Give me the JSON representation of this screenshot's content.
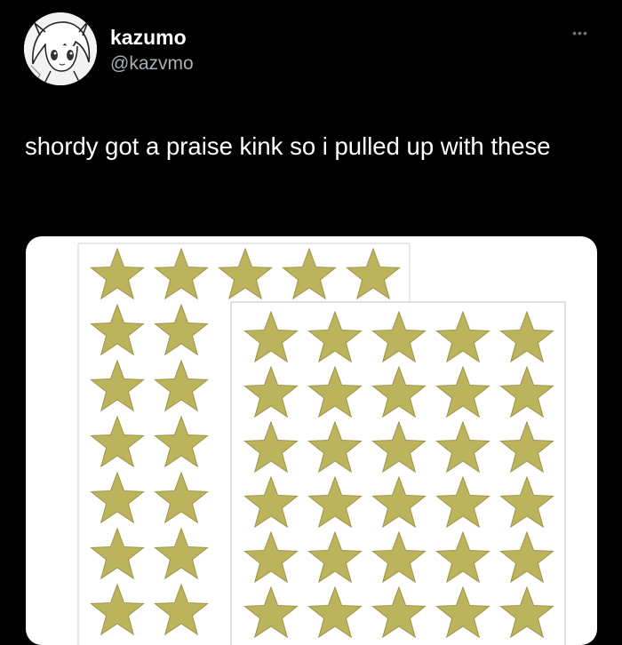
{
  "tweet": {
    "author": {
      "display_name": "kazumo",
      "handle": "@kazvmo",
      "avatar_icon": "anime-avatar-icon"
    },
    "more_icon": "more-options-icon",
    "more_glyph": "•••",
    "text": "shordy got a praise kink so i pulled up with these",
    "media": {
      "description_icon": "gold-star-stickers-image",
      "star_color": "#bcb45c",
      "star_outline": "#9d9547"
    }
  }
}
